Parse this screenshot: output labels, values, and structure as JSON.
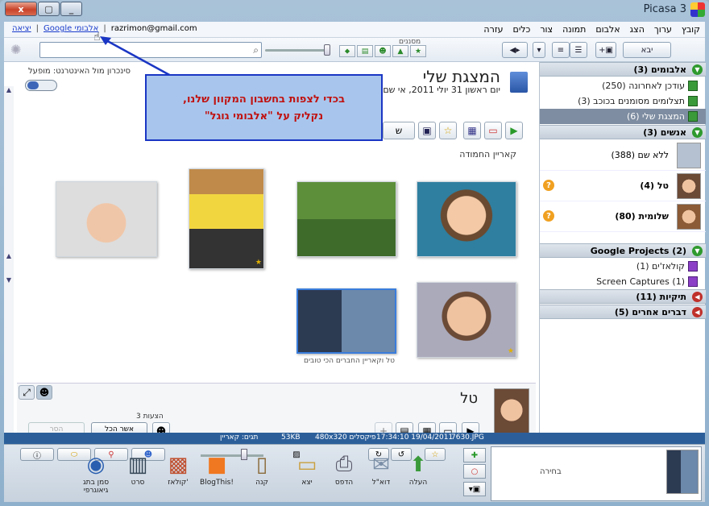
{
  "window": {
    "title": "Picasa 3",
    "btn_close": "x",
    "btn_max": "▢",
    "btn_min": "_"
  },
  "menu": [
    "קובץ",
    "ערוך",
    "הצג",
    "אלבום",
    "תמונה",
    "צור",
    "כלים",
    "עזרה"
  ],
  "links": {
    "exit": "יציאה",
    "google_albums": "Google אלבומי",
    "email": "razrimon@gmail.com"
  },
  "toolbar": {
    "import_label": "יבא",
    "filters_label": "מסננים"
  },
  "sidebar": {
    "albums_head": "אלבומים (3)",
    "albums": [
      {
        "label": "עודכן לאחרונה (250)"
      },
      {
        "label": "תצלומים מסומנים בכוכב (3)"
      },
      {
        "label": "המצגת שלי (6)"
      }
    ],
    "people_head": "אנשים (3)",
    "people": [
      {
        "label": "ללא שם (388)"
      },
      {
        "label": "טל (4)"
      },
      {
        "label": "שלומית (80)"
      }
    ],
    "projects_head": "Google Projects (2)",
    "projects": [
      {
        "label": "קולאז'ים (1)"
      },
      {
        "label": "Screen Captures (1)"
      }
    ],
    "folders_head": "תיקיות (11)",
    "other_head": "דברים אחרים (5)"
  },
  "album": {
    "title": "המצגת שלי",
    "date": "יום ראשון 31 יולי 2011, אי שם",
    "sync_label": "סינכרון מול האינטרנט: מופעל",
    "section_label": "קאריין החמודה",
    "photo_caption": "טל וקאריין החברים הכי טובים",
    "share_label": "ש"
  },
  "people_strip": {
    "name": "טל",
    "faces_count": "3 הצעות",
    "confirm_all": "אשר הכל",
    "remove": "הסר"
  },
  "status": {
    "filename": "7630.JPG",
    "datetime": "17:34:10 19/04/2011",
    "dims": "480x320 פיקסלים",
    "size": "53KB",
    "tags": "תגים: קאריין"
  },
  "tray": {
    "selection_label": "בחירה",
    "tools": [
      "העלה",
      "דוא\"ל",
      "הדפס",
      "יצא",
      "קנה",
      "BlogThis!",
      "קולאז'",
      "סרט",
      "סמן בתג גיאוגרפי"
    ]
  },
  "callout": {
    "line1": "בכדי לצפות בחשבון המקוון שלנו,",
    "line2": "נקליק על \"אלבומי גוגל\""
  },
  "colors": {
    "status_bar": "#2c5f9a",
    "callout_bg": "#a8c6ed",
    "callout_border": "#1a36c4",
    "callout_text": "#c0110f"
  }
}
